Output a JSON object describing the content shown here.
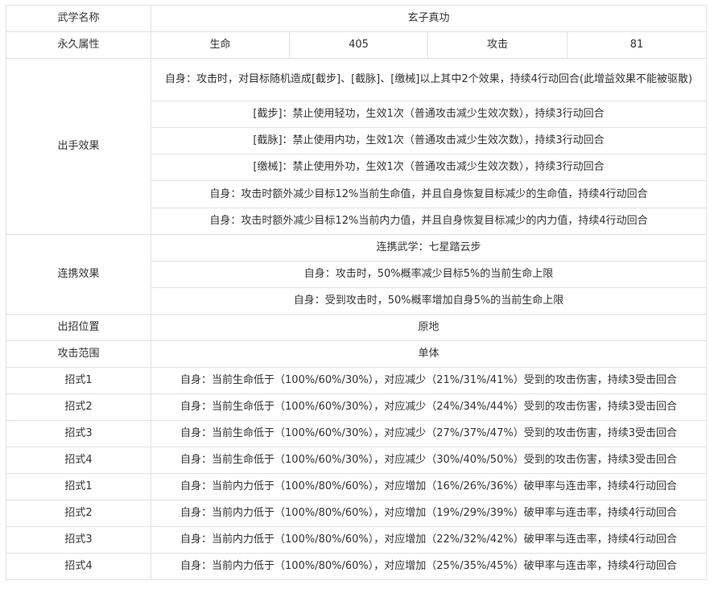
{
  "rows": {
    "name": {
      "label": "武学名称",
      "value": "玄子真功"
    },
    "attrs": {
      "label": "永久属性",
      "hp_label": "生命",
      "hp_value": "405",
      "atk_label": "攻击",
      "atk_value": "81"
    },
    "on_hit": {
      "label": "出手效果",
      "effects": [
        "自身：攻击时，对目标随机造成[截步]、[截脉]、[缴械]以上其中2个效果，持续4行动回合(此增益效果不能被驱散)",
        "[截步]：禁止使用轻功，生效1次（普通攻击减少生效次数），持续3行动回合",
        "[截脉]：禁止使用内功，生效1次（普通攻击减少生效次数），持续3行动回合",
        "[缴械]：禁止使用外功，生效1次（普通攻击减少生效次数），持续3行动回合",
        "自身：攻击时额外减少目标12%当前生命值，并且自身恢复目标减少的生命值，持续4行动回合",
        "自身：攻击时额外减少目标12%当前内力值，并且自身恢复目标减少的内力值，持续4行动回合"
      ]
    },
    "combo": {
      "label": "连携效果",
      "effects": [
        "连携武学：七星踏云步",
        "自身：攻击时，50%概率减少目标5%的当前生命上限",
        "自身：受到攻击时，50%概率增加自身5%的当前生命上限"
      ]
    },
    "position": {
      "label": "出招位置",
      "value": "原地"
    },
    "range": {
      "label": "攻击范围",
      "value": "单体"
    },
    "moves": [
      {
        "label": "招式1",
        "value": "自身：当前生命低于（100%/60%/30%），对应减少（21%/31%/41%）受到的攻击伤害，持续3受击回合"
      },
      {
        "label": "招式2",
        "value": "自身：当前生命低于（100%/60%/30%），对应减少（24%/34%/44%）受到的攻击伤害，持续3受击回合"
      },
      {
        "label": "招式3",
        "value": "自身：当前生命低于（100%/60%/30%），对应减少（27%/37%/47%）受到的攻击伤害，持续3受击回合"
      },
      {
        "label": "招式4",
        "value": "自身：当前生命低于（100%/60%/30%），对应减少（30%/40%/50%）受到的攻击伤害，持续3受击回合"
      },
      {
        "label": "招式1",
        "value": "自身：当前内力低于（100%/80%/60%），对应增加（16%/26%/36%）破甲率与连击率，持续4行动回合"
      },
      {
        "label": "招式2",
        "value": "自身：当前内力低于（100%/80%/60%），对应增加（19%/29%/39%）破甲率与连击率，持续4行动回合"
      },
      {
        "label": "招式3",
        "value": "自身：当前内力低于（100%/80%/60%），对应增加（22%/32%/42%）破甲率与连击率，持续4行动回合"
      },
      {
        "label": "招式4",
        "value": "自身：当前内力低于（100%/80%/60%），对应增加（25%/35%/45%）破甲率与连击率，持续4行动回合"
      }
    ]
  }
}
